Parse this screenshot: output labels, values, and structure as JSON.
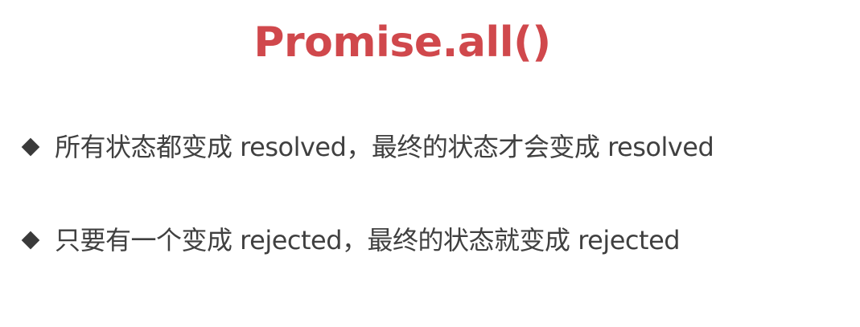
{
  "slide": {
    "title": "Promise.all()",
    "bullets": [
      {
        "icon": "diamond-bullet-icon",
        "text": "所有状态都变成 resolved，最终的状态才会变成 resolved"
      },
      {
        "icon": "diamond-bullet-icon",
        "text": "只要有一个变成 rejected，最终的状态就变成 rejected"
      }
    ]
  },
  "colors": {
    "title": "#d0484c",
    "text": "#404040",
    "bullet_icon": "#3a3a3a",
    "background": "#ffffff"
  }
}
